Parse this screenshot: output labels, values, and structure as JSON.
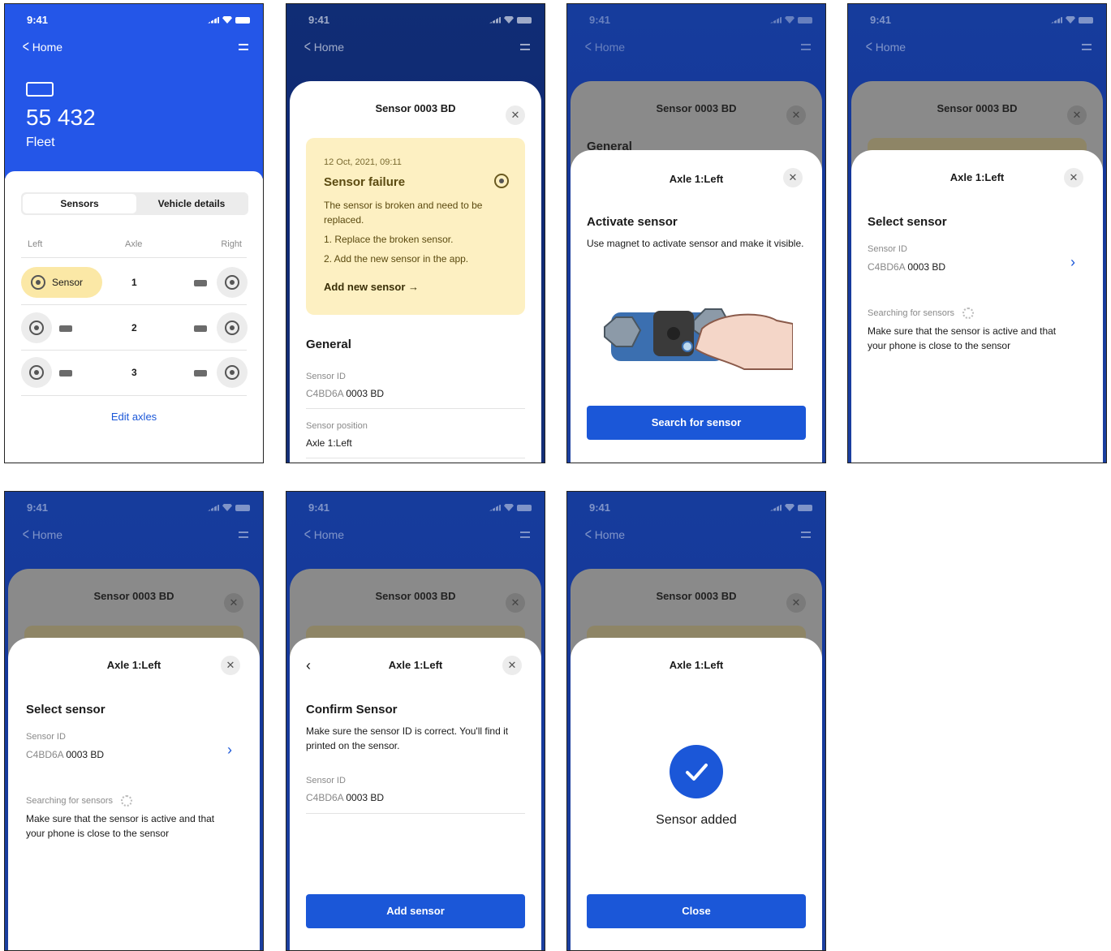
{
  "status": {
    "time": "9:41"
  },
  "nav": {
    "back": "Home"
  },
  "screen1": {
    "vehicle_number": "55 432",
    "fleet": "Fleet",
    "tabs": [
      "Sensors",
      "Vehicle details"
    ],
    "col_left": "Left",
    "col_axle": "Axle",
    "col_right": "Right",
    "sensor_label": "Sensor",
    "axles": [
      "1",
      "2",
      "3"
    ],
    "edit_axles": "Edit axles"
  },
  "screen2": {
    "title": "Sensor 0003 BD",
    "alert": {
      "date": "12 Oct, 2021, 09:11",
      "title": "Sensor failure",
      "body": "The sensor is broken and need to be replaced.",
      "step1": "1. Replace the broken sensor.",
      "step2": "2. Add the new sensor in the app.",
      "action": "Add new sensor →"
    },
    "general": "General",
    "sensor_id_label": "Sensor ID",
    "sensor_id_prefix": "C4BD6A",
    "sensor_id_suffix": "0003 BD",
    "position_label": "Sensor position",
    "position_value": "Axle 1:Left"
  },
  "screen3": {
    "behind_title": "Sensor 0003 BD",
    "behind_general": "General",
    "title": "Axle 1:Left",
    "heading": "Activate sensor",
    "body": "Use magnet to activate sensor and make it visible.",
    "button": "Search for sensor"
  },
  "screen4": {
    "behind_title": "Sensor 0003 BD",
    "title": "Axle 1:Left",
    "heading": "Select sensor",
    "sensor_id_label": "Sensor ID",
    "sensor_id_prefix": "C4BD6A",
    "sensor_id_suffix": "0003 BD",
    "searching": "Searching for sensors",
    "hint": "Make sure that the sensor is active and that your phone is close to the sensor"
  },
  "screen6": {
    "behind_title": "Sensor 0003 BD",
    "title": "Axle 1:Left",
    "heading": "Confirm Sensor",
    "body": "Make sure the sensor ID is correct. You'll find it printed on the sensor.",
    "sensor_id_label": "Sensor ID",
    "sensor_id_prefix": "C4BD6A",
    "sensor_id_suffix": "0003 BD",
    "button": "Add sensor"
  },
  "screen7": {
    "behind_title": "Sensor 0003 BD",
    "title": "Axle 1:Left",
    "message": "Sensor added",
    "button": "Close"
  },
  "colors": {
    "primary": "#1b57d8",
    "header_blue": "#2456e8",
    "alert_bg": "#fdf0c2"
  }
}
